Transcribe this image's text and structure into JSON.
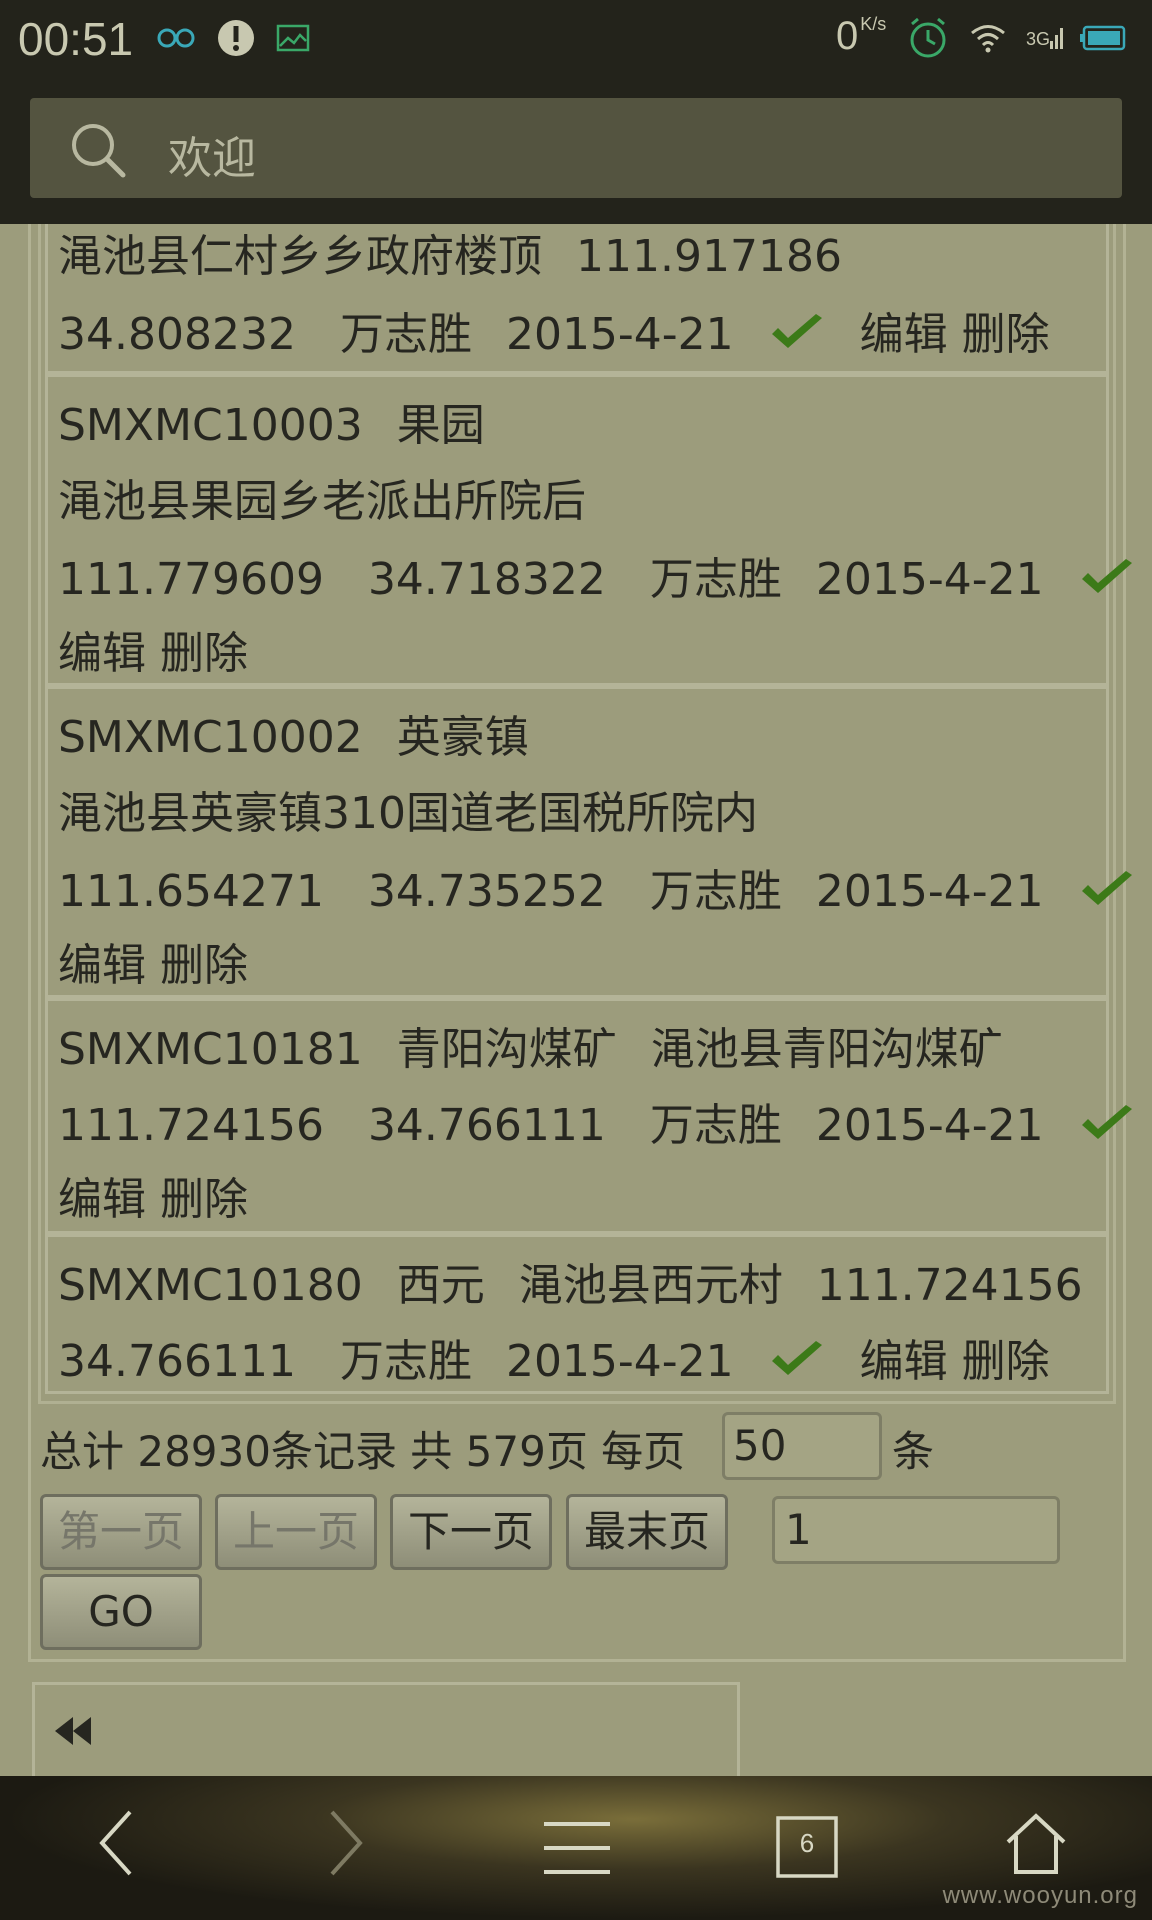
{
  "status_bar": {
    "time": "00:51",
    "net_speed": "0",
    "net_unit": "K/s",
    "icons": [
      "infinity-icon",
      "alert-icon",
      "image-icon",
      "alarm-icon",
      "wifi-icon",
      "signal-icon",
      "battery-icon"
    ]
  },
  "search": {
    "placeholder": "欢迎"
  },
  "records": [
    {
      "lines": [
        "渑池县仁村乡乡政府楼顶",
        "111.917186"
      ],
      "line2": [
        "34.808232",
        "万志胜",
        "2015-4-21"
      ],
      "edit": "编辑",
      "delete": "删除"
    },
    {
      "code": "SMXMC10003",
      "name": "果园",
      "address": "渑池县果园乡老派出所院后",
      "lon": "111.779609",
      "lat": "34.718322",
      "user": "万志胜",
      "date": "2015-4-21",
      "edit": "编辑",
      "delete": "删除"
    },
    {
      "code": "SMXMC10002",
      "name": "英豪镇",
      "address": "渑池县英豪镇310国道老国税所院内",
      "lon": "111.654271",
      "lat": "34.735252",
      "user": "万志胜",
      "date": "2015-4-21",
      "edit": "编辑",
      "delete": "删除"
    },
    {
      "code": "SMXMC10181",
      "name": "青阳沟煤矿",
      "address": "渑池县青阳沟煤矿",
      "lon": "111.724156",
      "lat": "34.766111",
      "user": "万志胜",
      "date": "2015-4-21",
      "edit": "编辑",
      "delete": "删除"
    },
    {
      "code": "SMXMC10180",
      "name": "西元",
      "address": "渑池县西元村",
      "lon": "111.724156",
      "lat": "34.766111",
      "user": "万志胜",
      "date": "2015-4-21",
      "edit": "编辑",
      "delete": "删除"
    }
  ],
  "pagination": {
    "summary": "总计 28930条记录 共 579页 每页",
    "per_page": "50",
    "unit": "条",
    "first": "第一页",
    "prev": "上一页",
    "next": "下一页",
    "last": "最末页",
    "page_input": "1",
    "go": "GO"
  },
  "nav": {
    "tab_count": "6"
  },
  "watermark": "www.wooyun.org"
}
